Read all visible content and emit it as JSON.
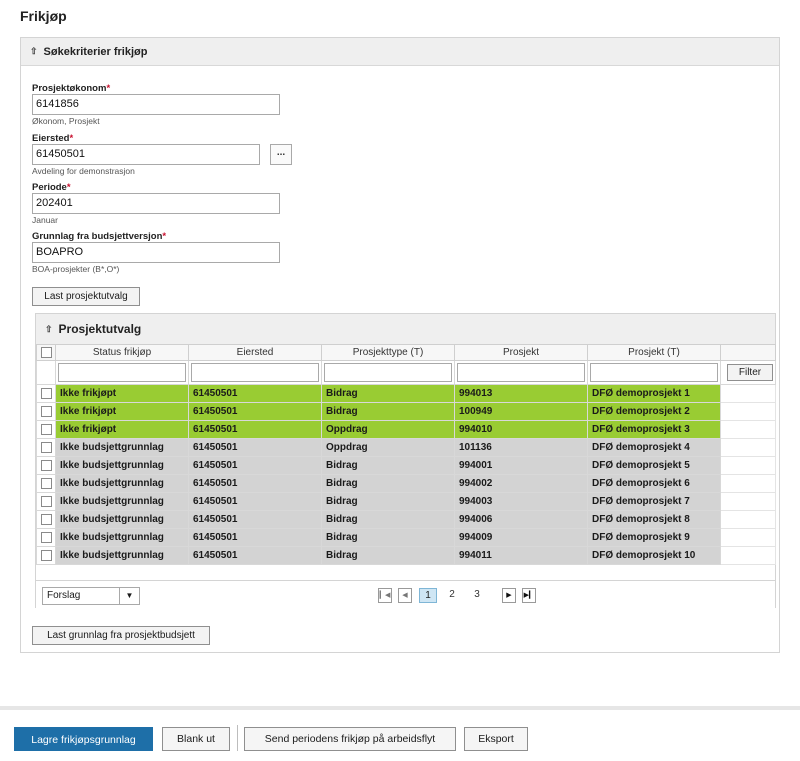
{
  "page": {
    "title": "Frikjøp"
  },
  "search_panel": {
    "title": "Søkekriterier frikjøp",
    "required_marker": "*",
    "fields": [
      {
        "label": "Prosjektøkonom",
        "value": "6141856",
        "hint": "Økonom, Prosjekt"
      },
      {
        "label": "Eiersted",
        "value": "61450501",
        "hint": "Avdeling for demonstrasjon",
        "browse": "..."
      },
      {
        "label": "Periode",
        "value": "202401",
        "hint": "Januar"
      },
      {
        "label": "Grunnlag fra budsjettversjon",
        "value": "BOAPRO",
        "hint": "BOA-prosjekter (B*,O*)"
      }
    ],
    "load_button": "Last prosjektutvalg",
    "load_budget_button": "Last grunnlag fra prosjektbudsjett"
  },
  "project_panel": {
    "title": "Prosjektutvalg",
    "columns": [
      "Status frikjøp",
      "Eiersted",
      "Prosjekttype (T)",
      "Prosjekt",
      "Prosjekt (T)"
    ],
    "filter_button": "Filter",
    "rows": [
      {
        "status": "Ikke frikjøpt",
        "eiersted": "61450501",
        "type": "Bidrag",
        "prosjekt": "994013",
        "prosjekt_t": "DFØ demoprosjekt 1",
        "color": "#99cc33"
      },
      {
        "status": "Ikke frikjøpt",
        "eiersted": "61450501",
        "type": "Bidrag",
        "prosjekt": "100949",
        "prosjekt_t": "DFØ demoprosjekt 2",
        "color": "#99cc33"
      },
      {
        "status": "Ikke frikjøpt",
        "eiersted": "61450501",
        "type": "Oppdrag",
        "prosjekt": "994010",
        "prosjekt_t": "DFØ demoprosjekt 3",
        "color": "#99cc33"
      },
      {
        "status": "Ikke budsjettgrunnlag",
        "eiersted": "61450501",
        "type": "Oppdrag",
        "prosjekt": "101136",
        "prosjekt_t": "DFØ demoprosjekt 4",
        "color": "#d3d3d3"
      },
      {
        "status": "Ikke budsjettgrunnlag",
        "eiersted": "61450501",
        "type": "Bidrag",
        "prosjekt": "994001",
        "prosjekt_t": "DFØ demoprosjekt 5",
        "color": "#d3d3d3"
      },
      {
        "status": "Ikke budsjettgrunnlag",
        "eiersted": "61450501",
        "type": "Bidrag",
        "prosjekt": "994002",
        "prosjekt_t": "DFØ demoprosjekt 6",
        "color": "#d3d3d3"
      },
      {
        "status": "Ikke budsjettgrunnlag",
        "eiersted": "61450501",
        "type": "Bidrag",
        "prosjekt": "994003",
        "prosjekt_t": "DFØ demoprosjekt 7",
        "color": "#d3d3d3"
      },
      {
        "status": "Ikke budsjettgrunnlag",
        "eiersted": "61450501",
        "type": "Bidrag",
        "prosjekt": "994006",
        "prosjekt_t": "DFØ demoprosjekt 8",
        "color": "#d3d3d3"
      },
      {
        "status": "Ikke budsjettgrunnlag",
        "eiersted": "61450501",
        "type": "Bidrag",
        "prosjekt": "994009",
        "prosjekt_t": "DFØ demoprosjekt 9",
        "color": "#d3d3d3"
      },
      {
        "status": "Ikke budsjettgrunnlag",
        "eiersted": "61450501",
        "type": "Bidrag",
        "prosjekt": "994011",
        "prosjekt_t": "DFØ demoprosjekt 10",
        "color": "#d3d3d3"
      }
    ],
    "pager": {
      "layout_select": "Forslag",
      "pages": [
        "1",
        "2",
        "3"
      ],
      "current_page": "1",
      "first_icon": "first-page-icon",
      "prev_icon": "prev-page-icon",
      "next_icon": "next-page-icon",
      "last_icon": "last-page-icon"
    }
  },
  "footer": {
    "save_button": "Lagre frikjøpsgrunnlag",
    "blank_button": "Blank ut",
    "send_button": "Send periodens frikjøp på arbeidsflyt",
    "export_button": "Eksport",
    "accent_color": "#1e6fa8"
  }
}
